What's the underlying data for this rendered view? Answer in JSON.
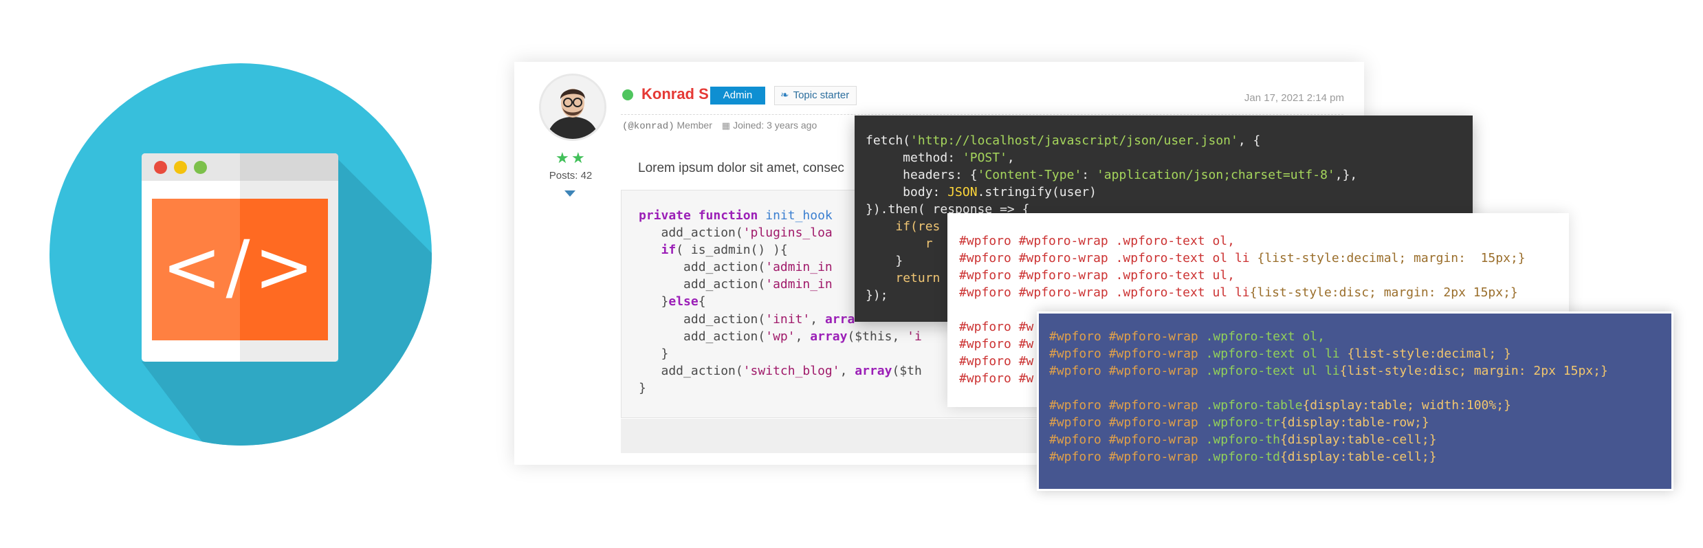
{
  "illustration": {
    "icon_symbol": "</>",
    "icon": "code-window-icon",
    "colors": {
      "circle": "#37bfdc",
      "panel_left": "#ff8041",
      "panel_right": "#ff6a22"
    }
  },
  "post": {
    "author_name": "Konrad S",
    "role_badge": "Admin",
    "topic_badge": "Topic starter",
    "date": "Jan 17, 2021 2:14 pm",
    "handle": "(@konrad)",
    "member_type": "Member",
    "joined": "Joined: 3 years ago",
    "posts_count": "Posts: 42",
    "rating_stars": 2,
    "body_text": "Lorem ipsum dolor sit amet, consec",
    "colors": {
      "author": "#e53935",
      "admin_badge": "#0f8fd2",
      "online": "#4fc55e"
    }
  },
  "php_code": {
    "lines": [
      [
        "private function ",
        "init_hook"
      ],
      [
        "   add_action(",
        "'plugins_loa"
      ],
      [
        "   if",
        "( is_admin() ){"
      ],
      [
        "      add_action(",
        "'admin_in"
      ],
      [
        "      add_action(",
        "'admin_in"
      ],
      [
        "   }",
        "else",
        "{"
      ],
      [
        "      add_action(",
        "'init'",
        ", ",
        "arra"
      ],
      [
        "      add_action(",
        "'wp'",
        ", ",
        "array",
        "($this, ",
        "'i"
      ],
      [
        "   }"
      ],
      [
        "   add_action(",
        "'switch_blog'",
        ", ",
        "array",
        "($th"
      ],
      [
        "}"
      ]
    ]
  },
  "js_code": {
    "url": "'http://localhost/javascript/json/user.json'",
    "method": "'POST'",
    "content_type_key": "'Content-Type'",
    "content_type_val": "'application/json;charset=utf-8'",
    "json_obj": "JSON",
    "if_text": "if(res",
    "hidden_r": "r",
    "return_text": "return",
    "then_text": "}).then( response => {"
  },
  "css_code": {
    "line1": "#wpforo #wpforo-wrap .wpforo-text ol,",
    "line2_sel": "#wpforo #wpforo-wrap .wpforo-text ol li ",
    "line2_decl": "{list-style:decimal; margin:  15px;}",
    "line3": "#wpforo #wpforo-wrap .wpforo-text ul,",
    "line4_sel": "#wpforo #wpforo-wrap .wpforo-text ul li",
    "line4_decl": "{list-style:disc; margin: 2px 15px;}",
    "partial": [
      "#wpforo #w",
      "#wpforo #w",
      "#wpforo #w",
      "#wpforo #w"
    ]
  },
  "blue_code": {
    "prefix": "#wpforo #wpforo-wrap ",
    "lines": [
      {
        "cls": ".wpforo-text ol,",
        "decl": ""
      },
      {
        "cls": ".wpforo-text ol li ",
        "decl": "{list-style:decimal; }"
      },
      {
        "cls": ".wpforo-text ul li",
        "decl": "{list-style:disc; margin: 2px 15px;}"
      },
      {
        "cls": "",
        "decl": ""
      },
      {
        "cls": ".wpforo-table",
        "decl": "{display:table; width:100%;}"
      },
      {
        "cls": ".wpforo-tr",
        "decl": "{display:table-row;}"
      },
      {
        "cls": ".wpforo-th",
        "decl": "{display:table-cell;}"
      },
      {
        "cls": ".wpforo-td",
        "decl": "{display:table-cell;}"
      }
    ]
  }
}
